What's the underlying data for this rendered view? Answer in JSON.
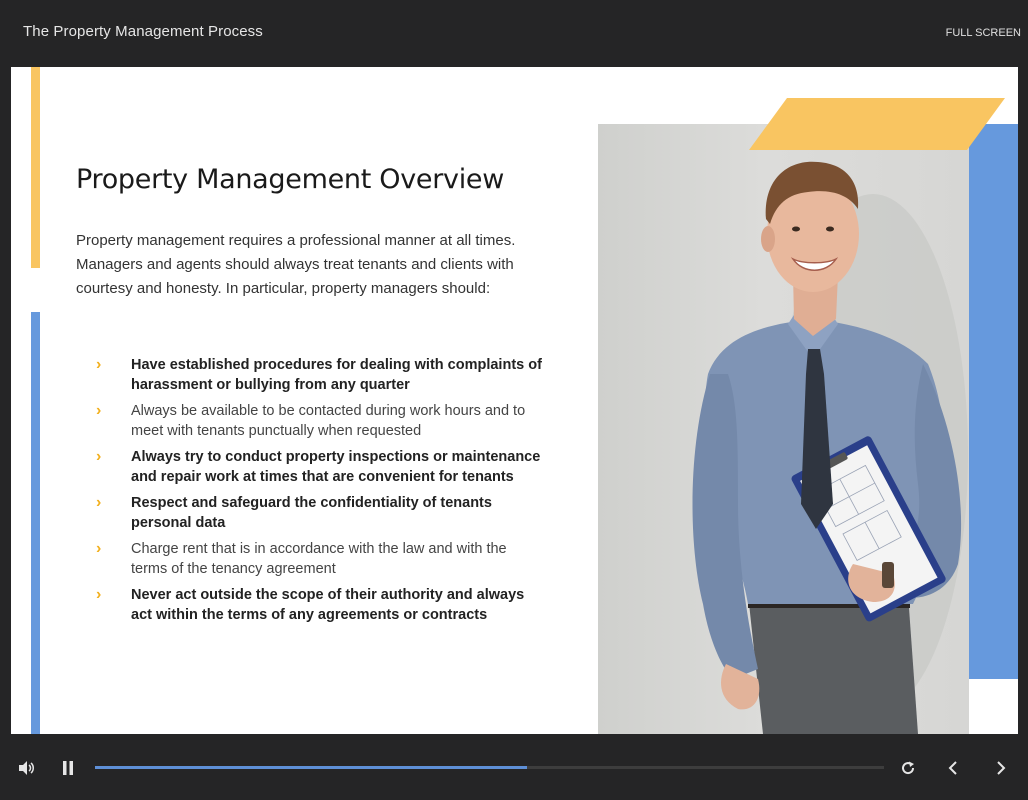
{
  "player": {
    "course_title": "The Property Management Process",
    "fullscreen_label": "FULL SCREEN",
    "progress_fraction": 0.548,
    "colors": {
      "background": "#252526",
      "progress": "#5e8fd6"
    }
  },
  "slide": {
    "heading": "Property Management Overview",
    "intro": "Property management requires a professional manner at all times. Managers and agents should always treat tenants and clients with courtesy and honesty. In particular, property managers should:",
    "bullets": [
      {
        "text": "Have established procedures for dealing with complaints of harassment or bullying from any quarter",
        "bold": true
      },
      {
        "text": "Always be available to be contacted during work hours and to meet with tenants punctually when requested",
        "bold": false
      },
      {
        "text": "Always try to conduct property inspections or maintenance and repair work at times that are convenient for tenants",
        "bold": true
      },
      {
        "text": "Respect and safeguard the confidentiality of tenants personal data",
        "bold": true
      },
      {
        "text": "Charge rent that is in accordance with the law and with the terms of the tenancy agreement",
        "bold": false
      },
      {
        "text": "Never act outside the scope of their authority and always act within the terms of any agreements or contracts",
        "bold": true
      }
    ],
    "bullet_icon": "chevron-right-icon",
    "colors": {
      "accent_yellow": "#f9c561",
      "accent_blue": "#6699dd",
      "chevron": "#f2b01e"
    }
  },
  "controls": {
    "volume_icon": "volume-icon",
    "pause_icon": "pause-icon",
    "replay_icon": "replay-icon",
    "prev_icon": "chevron-left-icon",
    "next_icon": "chevron-right-icon"
  }
}
